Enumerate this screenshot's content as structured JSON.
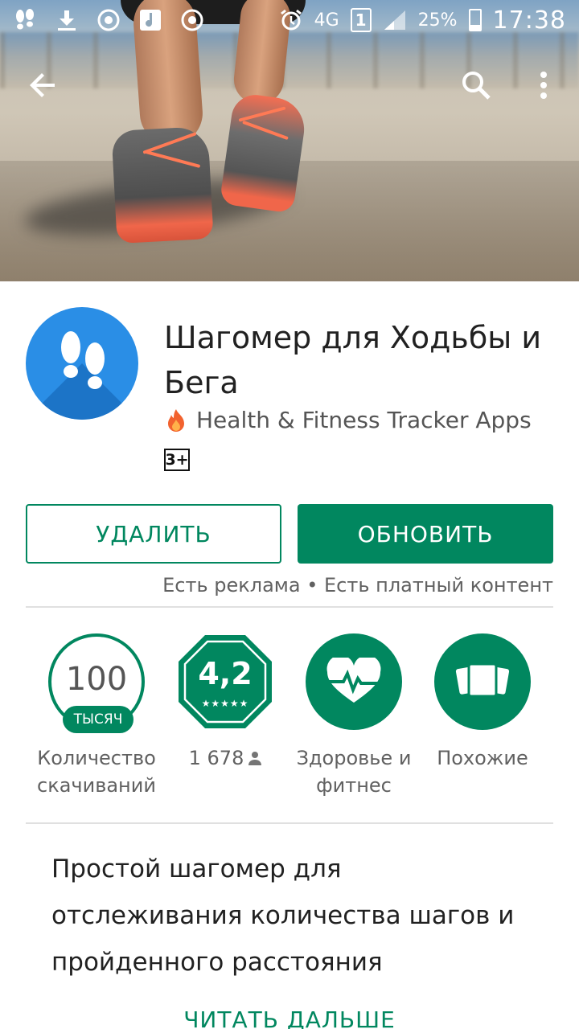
{
  "status_bar": {
    "icons": [
      "footsteps-icon",
      "download-icon",
      "chrome-icon",
      "music-icon",
      "chrome-icon"
    ],
    "alarm_icon": "alarm-icon",
    "network": "4G",
    "sim": "1",
    "battery_percent": "25%",
    "time": "17:38"
  },
  "toolbar": {
    "back_icon": "arrow-back-icon",
    "search_icon": "search-icon",
    "more_icon": "more-vert-icon"
  },
  "app": {
    "title": "Шагомер для Ходьбы и Бега",
    "developer": "Health & Fitness Tracker Apps",
    "developer_badge_icon": "fire-icon",
    "age_rating": "3+"
  },
  "actions": {
    "uninstall_label": "УДАЛИТЬ",
    "update_label": "ОБНОВИТЬ",
    "ads_note": "Есть реклама • Есть платный контент"
  },
  "stats": {
    "downloads_number": "100",
    "downloads_unit": "ТЫСЯЧ",
    "downloads_label": "Количество скачиваний",
    "rating_value": "4,2",
    "rating_stars": "★★★★★",
    "rating_count": "1 678",
    "category_label": "Здоровье и фитнес",
    "similar_label": "Похожие"
  },
  "description": {
    "text": "Простой шагомер для отслеживания количества шагов и пройденного расстояния",
    "read_more": "ЧИТАТЬ ДАЛЬШЕ"
  },
  "colors": {
    "accent": "#01875f",
    "app_icon": "#2a8ee6"
  }
}
